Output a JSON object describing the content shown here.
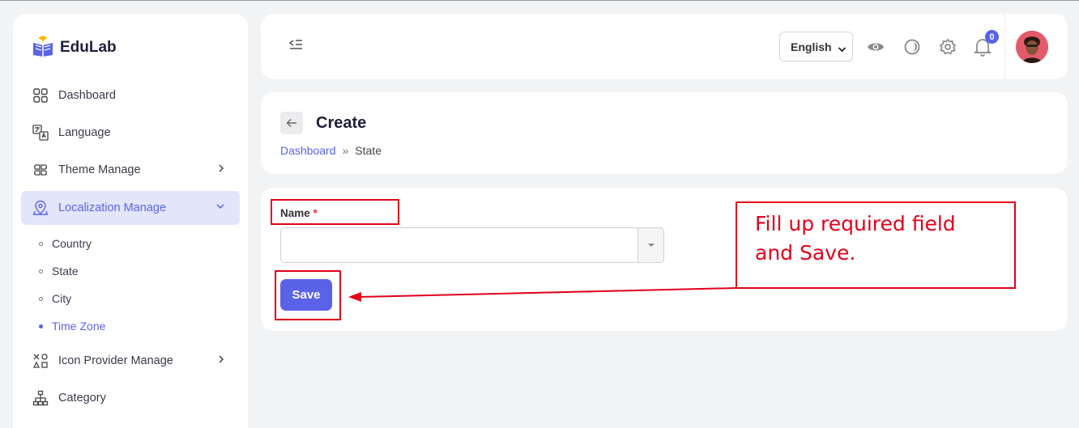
{
  "app": {
    "name": "EduLab"
  },
  "sidebar": {
    "items": [
      {
        "label": "Dashboard"
      },
      {
        "label": "Language"
      },
      {
        "label": "Theme Manage"
      },
      {
        "label": "Localization Manage"
      },
      {
        "label": "Icon Provider Manage"
      },
      {
        "label": "Category"
      }
    ],
    "sub_items": [
      {
        "label": "Country"
      },
      {
        "label": "State"
      },
      {
        "label": "City"
      },
      {
        "label": "Time Zone"
      }
    ]
  },
  "topbar": {
    "language": "English",
    "notification_count": "0"
  },
  "header": {
    "title": "Create",
    "breadcrumb": {
      "link": "Dashboard",
      "separator": "»",
      "current": "State"
    }
  },
  "form": {
    "name_label": "Name",
    "required_mark": "*",
    "name_value": "",
    "save_label": "Save"
  },
  "annotation": {
    "text": "Fill up required field and Save."
  },
  "colors": {
    "accent": "#5a63e8",
    "annotation": "#e3001b",
    "active_bg": "#e3e5fb"
  }
}
